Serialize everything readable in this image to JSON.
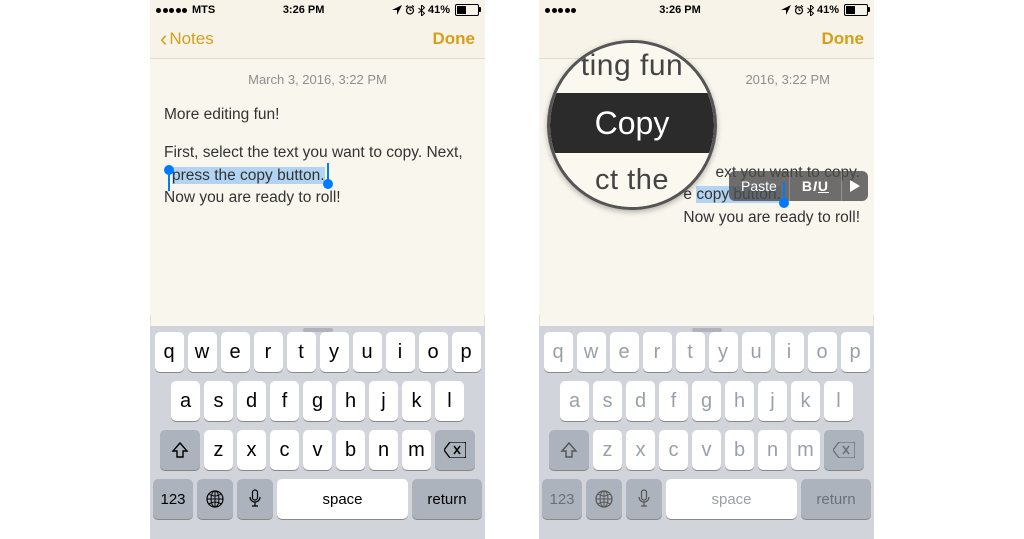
{
  "statusbar": {
    "carrier": "MTS",
    "time": "3:26 PM",
    "battery_pct": "41%"
  },
  "nav": {
    "back_label": "Notes",
    "done_label": "Done"
  },
  "note": {
    "timestamp": "March 3, 2016, 3:22 PM",
    "line1": "More editing fun!",
    "line2_pre": "First, select the text you want to copy. Next, ",
    "line2_sel": "press the copy button.",
    "line3": "Now you are ready to roll!"
  },
  "editmenu": {
    "paste": "Paste",
    "b": "B",
    "i": "I",
    "u": "U"
  },
  "magnifier": {
    "top_fragment": "ting fun",
    "action": "Copy",
    "bottom_fragment": "ct the"
  },
  "keyboard": {
    "row1": [
      "q",
      "w",
      "e",
      "r",
      "t",
      "y",
      "u",
      "i",
      "o",
      "p"
    ],
    "row2": [
      "a",
      "s",
      "d",
      "f",
      "g",
      "h",
      "j",
      "k",
      "l"
    ],
    "row3": [
      "z",
      "x",
      "c",
      "v",
      "b",
      "n",
      "m"
    ],
    "numkey": "123",
    "space": "space",
    "return": "return"
  },
  "phone2_note": {
    "line2a_visible": "ext you want to copy.",
    "line2b_pre_visible": "e ",
    "line2b_sel": "copy button.",
    "line3": "Now you are ready to roll!",
    "timestamp_partial": "2016, 3:22 PM"
  }
}
